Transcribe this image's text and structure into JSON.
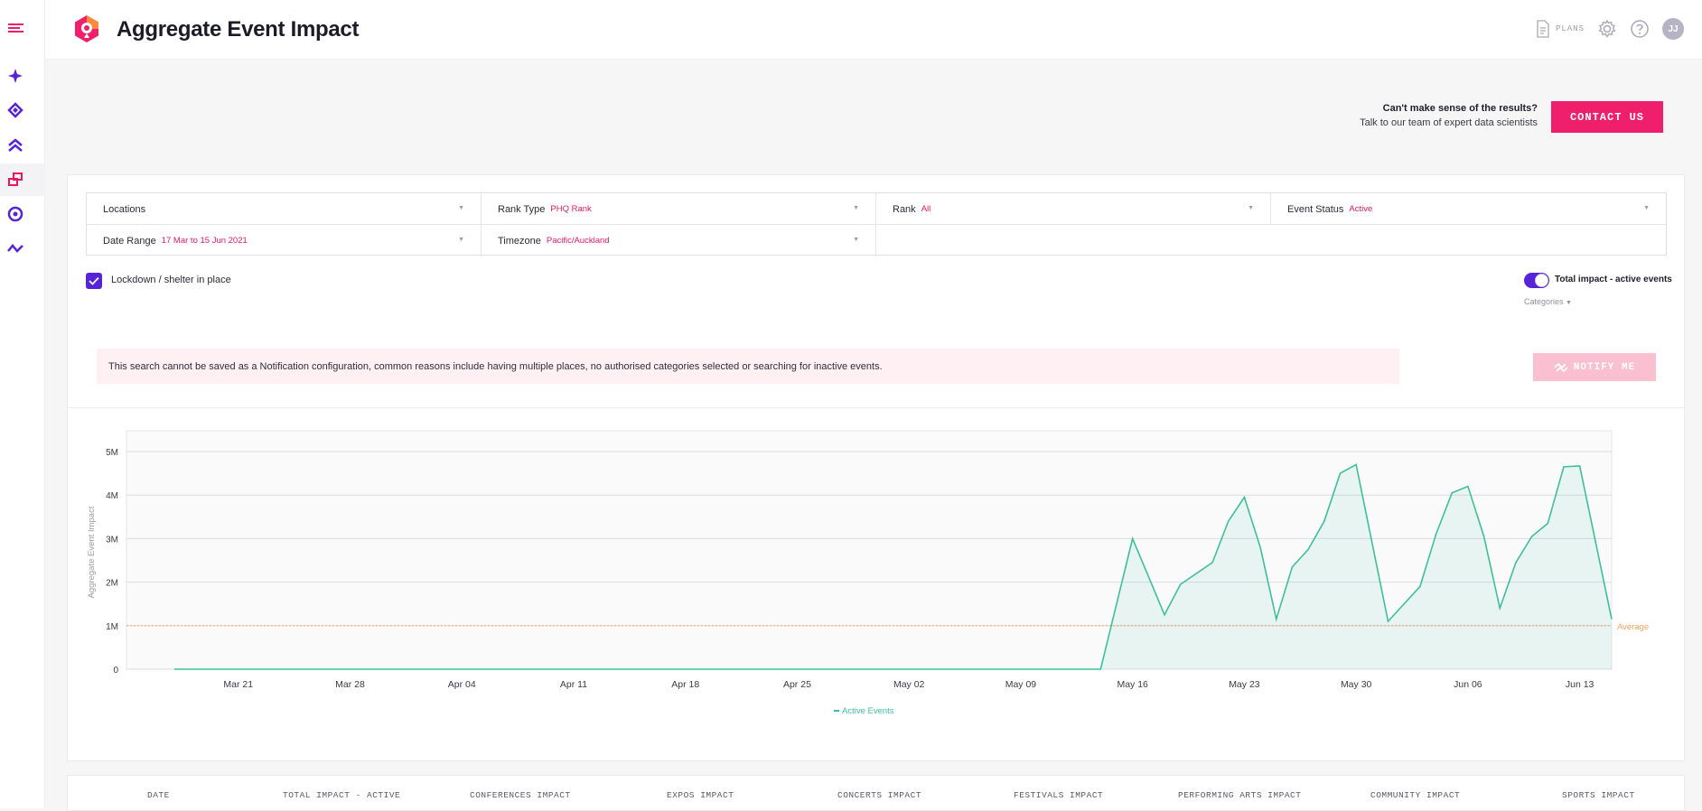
{
  "header": {
    "title": "Aggregate Event Impact",
    "plans_label": "PLANS",
    "avatar_initials": "JJ"
  },
  "contact": {
    "question": "Can't make sense of the results?",
    "subtext": "Talk to our team of expert data scientists",
    "button_label": "CONTACT US"
  },
  "filters": {
    "locations": {
      "label": "Locations",
      "value": ""
    },
    "rank_type": {
      "label": "Rank Type",
      "value": "PHQ Rank"
    },
    "rank": {
      "label": "Rank",
      "value": "All"
    },
    "event_status": {
      "label": "Event Status",
      "value": "Active"
    },
    "date_range": {
      "label": "Date Range",
      "value": "17 Mar to 15 Jun 2021"
    },
    "timezone": {
      "label": "Timezone",
      "value": "Pacific/Auckland"
    }
  },
  "lockdown": {
    "label": "Lockdown / shelter in place",
    "checked": true
  },
  "toggle": {
    "label": "Total impact - active events",
    "on": true
  },
  "categories_label": "Categories",
  "warning_text": "This search cannot be saved as a Notification configuration, common reasons include having multiple places, no authorised categories selected or searching for inactive events.",
  "notify_label": "NOTIFY ME",
  "colors": {
    "accent": "#ef1f6b",
    "purple": "#5623d8",
    "series": "#3cc197",
    "average": "#f5a35c"
  },
  "chart_data": {
    "type": "area",
    "ylabel": "Aggregate Event Impact",
    "y_ticks": [
      "0",
      "1M",
      "2M",
      "3M",
      "4M",
      "5M"
    ],
    "ylim": [
      0,
      5000000
    ],
    "x_tick_labels": [
      "Mar 21",
      "Mar 28",
      "Apr 04",
      "Apr 11",
      "Apr 18",
      "Apr 25",
      "May 02",
      "May 09",
      "May 16",
      "May 23",
      "May 30",
      "Jun 06",
      "Jun 13"
    ],
    "average_label": "Average",
    "average_value": 1000000,
    "legend_position": "bottom",
    "series": [
      {
        "name": "Active Events",
        "x": [
          "2021-03-17",
          "2021-05-14",
          "2021-05-16",
          "2021-05-18",
          "2021-05-19",
          "2021-05-20",
          "2021-05-21",
          "2021-05-22",
          "2021-05-23",
          "2021-05-24",
          "2021-05-25",
          "2021-05-26",
          "2021-05-27",
          "2021-05-28",
          "2021-05-29",
          "2021-05-30",
          "2021-06-01",
          "2021-06-03",
          "2021-06-04",
          "2021-06-05",
          "2021-06-06",
          "2021-06-07",
          "2021-06-08",
          "2021-06-09",
          "2021-06-10",
          "2021-06-11",
          "2021-06-12",
          "2021-06-13",
          "2021-06-15"
        ],
        "values": [
          0,
          0,
          3000000,
          1250000,
          1950000,
          2200000,
          2450000,
          3400000,
          3950000,
          2800000,
          1150000,
          2350000,
          2750000,
          3400000,
          4500000,
          4700000,
          1100000,
          1900000,
          3100000,
          4050000,
          4200000,
          3050000,
          1400000,
          2450000,
          3050000,
          3350000,
          4650000,
          4670000,
          1150000
        ]
      }
    ]
  },
  "table": {
    "headers": [
      "DATE",
      "TOTAL IMPACT - ACTIVE",
      "CONFERENCES IMPACT",
      "EXPOS IMPACT",
      "CONCERTS IMPACT",
      "FESTIVALS IMPACT",
      "PERFORMING ARTS IMPACT",
      "COMMUNITY IMPACT",
      "SPORTS IMPACT"
    ]
  }
}
